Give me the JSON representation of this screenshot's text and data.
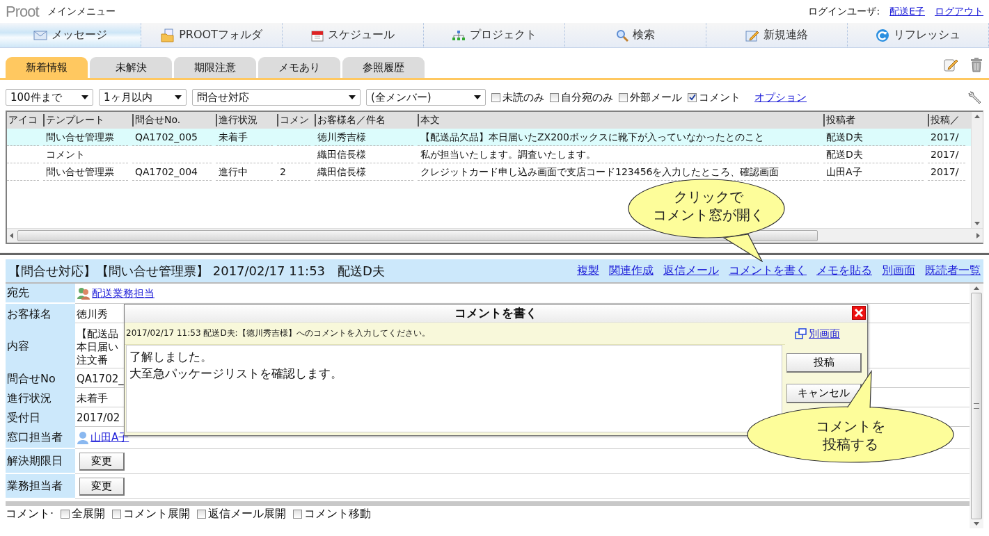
{
  "header": {
    "logo": "Proot",
    "title": "メインメニュー",
    "login_label": "ログインユーザ:",
    "user_link": "配送E子",
    "logout_link": "ログアウト"
  },
  "nav": [
    {
      "label": "メッセージ",
      "selected": true
    },
    {
      "label": "PROOTフォルダ",
      "selected": false
    },
    {
      "label": "スケジュール",
      "selected": false
    },
    {
      "label": "プロジェクト",
      "selected": false
    },
    {
      "label": "検索",
      "selected": false
    },
    {
      "label": "新規連絡",
      "selected": false
    },
    {
      "label": "リフレッシュ",
      "selected": false
    }
  ],
  "tabs": [
    {
      "label": "新着情報",
      "selected": true
    },
    {
      "label": "未解決",
      "selected": false
    },
    {
      "label": "期限注意",
      "selected": false
    },
    {
      "label": "メモあり",
      "selected": false
    },
    {
      "label": "参照履歴",
      "selected": false
    }
  ],
  "filters": {
    "selects": [
      {
        "value": "100件まで"
      },
      {
        "value": "1ヶ月以内"
      },
      {
        "value": "問合せ対応"
      },
      {
        "value": "(全メンバー)"
      }
    ],
    "checkboxes": [
      {
        "label": "未読のみ",
        "checked": false
      },
      {
        "label": "自分宛のみ",
        "checked": false
      },
      {
        "label": "外部メール",
        "checked": false
      },
      {
        "label": "コメント",
        "checked": true
      }
    ],
    "option_link": "オプション"
  },
  "table": {
    "columns": [
      "アイコ",
      "テンプレート",
      "問合せNo.",
      "進行状況",
      "コメン",
      "お客様名／件名",
      "本文",
      "投稿者",
      "投稿／"
    ],
    "rows": [
      {
        "selected": true,
        "cells": [
          "",
          "問い合せ管理票",
          "QA1702_005",
          "未着手",
          "",
          "徳川秀吉様",
          "【配送品欠品】本日届いたZX200ボックスに靴下が入っていなかったとのこと",
          "配送D夫",
          "2017/"
        ]
      },
      {
        "selected": false,
        "cells": [
          "",
          "コメント",
          "",
          "",
          "",
          "織田信長様",
          "私が担当いたします。調査いたします。",
          "配送D夫",
          "2017/"
        ]
      },
      {
        "selected": false,
        "cells": [
          "",
          "問い合せ管理票",
          "QA1702_004",
          "進行中",
          "2",
          "織田信長様",
          "クレジットカード申し込み画面で支店コード123456を入力したところ、確認画面",
          "山田A子",
          "2017/"
        ]
      }
    ]
  },
  "detail": {
    "title": "【問合せ対応】【問い合せ管理票】 2017/02/17 11:53　配送D夫",
    "links": [
      "複製",
      "関連作成",
      "返信メール",
      "コメントを書く",
      "メモを貼る",
      "別画面",
      "既読者一覧"
    ],
    "fields": [
      {
        "label": "宛先",
        "kind": "group_link",
        "lines": [
          "配送業務担当"
        ]
      },
      {
        "label": "お客様名",
        "kind": "text",
        "lines": [
          "徳川秀"
        ]
      },
      {
        "label": "内容",
        "kind": "text",
        "lines": [
          "【配送品",
          "本日届い",
          "注文番"
        ]
      },
      {
        "label": "問合せNo",
        "kind": "text",
        "lines": [
          "QA1702_"
        ]
      },
      {
        "label": "進行状況",
        "kind": "text",
        "lines": [
          "未着手"
        ]
      },
      {
        "label": "受付日",
        "kind": "text",
        "lines": [
          "2017/02"
        ]
      },
      {
        "label": "窓口担当者",
        "kind": "person_link",
        "lines": [
          "山田A子"
        ]
      },
      {
        "label": "解決期限日",
        "kind": "button",
        "lines": [
          "変更"
        ]
      },
      {
        "label": "業務担当者",
        "kind": "button",
        "lines": [
          "変更"
        ]
      }
    ],
    "expand_label": "コメント·",
    "expand_options": [
      {
        "label": "全展開",
        "checked": false
      },
      {
        "label": "コメント展開",
        "checked": false
      },
      {
        "label": "返信メール展開",
        "checked": false
      },
      {
        "label": "コメント移動",
        "checked": false
      }
    ]
  },
  "dialog": {
    "title": "コメントを書く",
    "info": "2017/02/17 11:53 配送D夫:【徳川秀吉様】へのコメントを入力してください。",
    "link": "別画面",
    "text_lines": [
      "了解しました。",
      "大至急パッケージリストを確認します。"
    ],
    "buttons": [
      "投稿",
      "キャンセル"
    ]
  },
  "callouts": [
    {
      "lines": [
        "クリックで",
        "コメント窓が開く"
      ]
    },
    {
      "lines": [
        "コメントを",
        "投稿する"
      ]
    }
  ]
}
